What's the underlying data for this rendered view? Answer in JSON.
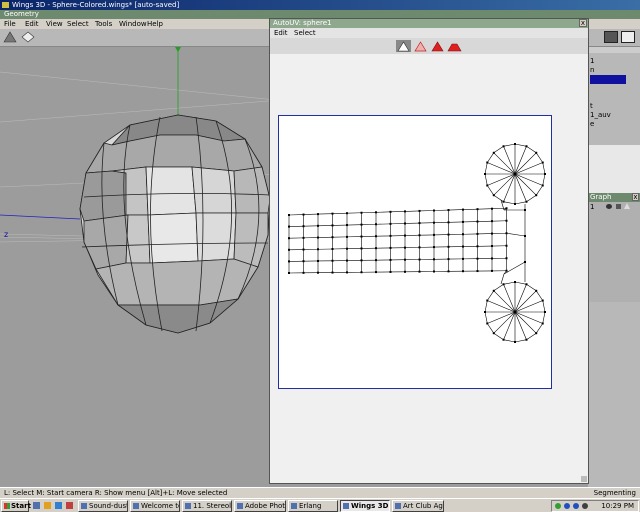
{
  "window": {
    "title": "Wings 3D - Sphere-Colored.wings* [auto-saved]"
  },
  "geometry_strip": {
    "label": "Geometry"
  },
  "menubar": {
    "items": [
      "File",
      "Edit",
      "View",
      "Select",
      "Tools",
      "Window",
      "Help"
    ]
  },
  "viewport": {
    "axis_label": "z"
  },
  "right_panel": {
    "lines": [
      "1",
      "n",
      "t",
      "1_auv",
      "e"
    ],
    "graph_label": "Graph",
    "graph_value": "1"
  },
  "uv_window": {
    "title": "AutoUV: sphere1",
    "close_glyph": "x",
    "menu": [
      "Edit",
      "Select"
    ],
    "modes": [
      "vertex",
      "edge",
      "face",
      "body"
    ]
  },
  "statusbar": {
    "text": "L: Select   M: Start camera   R: Show menu   [Alt]+L: Move selected",
    "right_text": "Segmenting"
  },
  "taskbar": {
    "start_label": "Start",
    "tasks": [
      "Sound-dust (...",
      "Welcome to t...",
      "11. Stereolab...",
      "Adobe Photo...",
      "Erlang",
      "Wings 3D - ...",
      "Art Club Age..."
    ],
    "clock": "10:29 PM"
  },
  "colors": {
    "title_bar": "#0a246a",
    "geometry_strip": "#6e8a6e",
    "uv_title": "#8ea88e",
    "uv_border": "#2030a0",
    "highlight": "#1010a0"
  }
}
